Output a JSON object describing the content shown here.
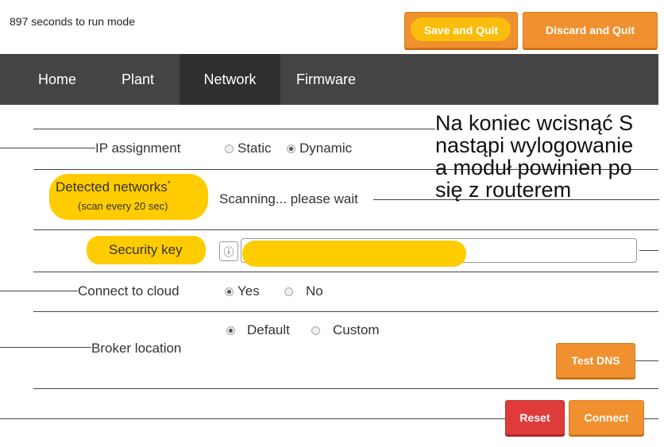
{
  "countdown": "897 seconds to run mode",
  "top_buttons": {
    "save": "Save and Quit",
    "discard": "Discard and Quit"
  },
  "nav": [
    {
      "label": "Home",
      "active": false
    },
    {
      "label": "Plant",
      "active": false
    },
    {
      "label": "Network",
      "active": true
    },
    {
      "label": "Firmware",
      "active": false
    }
  ],
  "form": {
    "ip_assignment": {
      "label": "IP assignment",
      "options": [
        "Static",
        "Dynamic"
      ],
      "selected": "Dynamic"
    },
    "detected_networks": {
      "label": "Detected networks",
      "asterisk": "*",
      "sublabel": "(scan every 20 sec)",
      "status": "Scanning... please wait"
    },
    "security_key": {
      "label": "Security key",
      "icon": "info-circle-icon",
      "value": ""
    },
    "connect_to_cloud": {
      "label": "Connect to cloud",
      "options": [
        "Yes",
        "No"
      ],
      "selected": "Yes"
    },
    "broker_location": {
      "label": "Broker location",
      "options": [
        "Default",
        "Custom"
      ],
      "selected": "Default",
      "test_button": "Test DNS"
    }
  },
  "bottom_buttons": {
    "reset": "Reset",
    "connect": "Connect"
  },
  "annotation": {
    "lines": [
      "Na koniec wcisnąć S",
      "nastąpi wylogowanie",
      "a moduł powinien po",
      "się z routerem"
    ]
  },
  "colors": {
    "accent": "#f0902e",
    "danger": "#e03b3b",
    "navbar": "#444444",
    "highlight": "#ffcc00"
  }
}
